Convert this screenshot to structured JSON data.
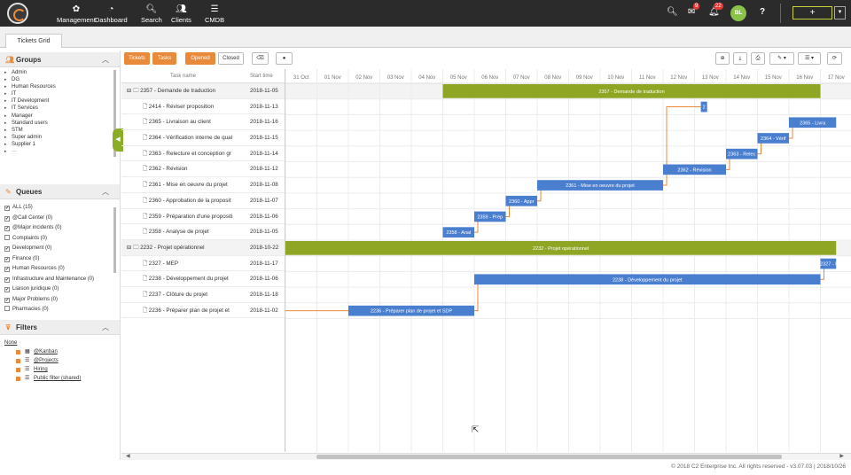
{
  "topbar": {
    "nav": [
      {
        "label": "Management",
        "icon": "gear-icon",
        "glyph": "✿"
      },
      {
        "label": "Dashboard",
        "icon": "dashboard-icon",
        "glyph": "◔"
      },
      {
        "label": "Search",
        "icon": "search-icon",
        "glyph": "🔍︎"
      },
      {
        "label": "Clients",
        "icon": "clients-icon",
        "glyph": "👥︎"
      },
      {
        "label": "CMDB",
        "icon": "database-icon",
        "glyph": "☰"
      }
    ],
    "messages_count": "9",
    "notifications_count": "22",
    "avatar_initials": "BL",
    "add_label": "+"
  },
  "tab": {
    "title": "Tickets Grid"
  },
  "sidebar": {
    "groups_title": "Groups",
    "groups": [
      "Admin",
      "DG",
      "Human Resources",
      "IT",
      "IT Development",
      "IT Services",
      "Manager",
      "Standard users",
      "STM",
      "Super admin",
      "Supplier 1",
      "···"
    ],
    "queues_title": "Queues",
    "queues": [
      {
        "label": "ALL (15)",
        "checked": true
      },
      {
        "label": "@Call Center (0)",
        "checked": true
      },
      {
        "label": "@Major incidents (0)",
        "checked": true
      },
      {
        "label": "Complaints (0)",
        "checked": false
      },
      {
        "label": "Development (0)",
        "checked": true
      },
      {
        "label": "Finance (0)",
        "checked": true
      },
      {
        "label": "Human Resources (0)",
        "checked": true
      },
      {
        "label": "Infrastructure and Maintenance (0)",
        "checked": true
      },
      {
        "label": "Liaison juridique (0)",
        "checked": true
      },
      {
        "label": "Major Problems (0)",
        "checked": true
      },
      {
        "label": "Pharmacies (0)",
        "checked": false
      }
    ],
    "filters_title": "Filters",
    "filters_none": "None",
    "filters": [
      "@Kanban",
      "@Projects",
      "Hiring",
      "Public filter (shared)"
    ]
  },
  "toolbar": {
    "tickets": "Tickets",
    "tasks": "Tasks",
    "opened": "Opened",
    "closed": "Closed"
  },
  "grid": {
    "col_task": "Task name",
    "col_start": "Start time",
    "rows": [
      {
        "name": "⊟ 🗀 2357 - Demande de traduction",
        "date": "2018-11-05",
        "parent": true
      },
      {
        "name": "🗋 2414 - Réviser proposition",
        "date": "2018-11-13",
        "parent": false
      },
      {
        "name": "🗋 2365 - Livraison au client",
        "date": "2018-11-16",
        "parent": false
      },
      {
        "name": "🗋 2364 - Vérification interne de qual",
        "date": "2018-11-15",
        "parent": false
      },
      {
        "name": "🗋 2363 - Relecture et conception gr",
        "date": "2018-11-14",
        "parent": false
      },
      {
        "name": "🗋 2362 - Révision",
        "date": "2018-11-12",
        "parent": false
      },
      {
        "name": "🗋 2361 - Mise en oeuvre du projet",
        "date": "2018-11-08",
        "parent": false
      },
      {
        "name": "🗋 2360 - Approbation de la proposit",
        "date": "2018-11-07",
        "parent": false
      },
      {
        "name": "🗋 2359 - Préparation d'une propositi",
        "date": "2018-11-06",
        "parent": false
      },
      {
        "name": "🗋 2358 - Analyse de projet",
        "date": "2018-11-05",
        "parent": false
      },
      {
        "name": "⊟ 🗀 2232 - Projet opérationnel",
        "date": "2018-10-22",
        "parent": true
      },
      {
        "name": "🗋 2327 - MEP",
        "date": "2018-11-17",
        "parent": false
      },
      {
        "name": "🗋 2238 - Développement du projet",
        "date": "2018-11-06",
        "parent": false
      },
      {
        "name": "🗋 2237 - Clôture du projet",
        "date": "2018-11-18",
        "parent": false
      },
      {
        "name": "🗋 2236 - Préparer plan de projet et",
        "date": "2018-11-02",
        "parent": false
      }
    ]
  },
  "timeline": {
    "days": [
      "31 Oct",
      "01 Nov",
      "02 Nov",
      "03 Nov",
      "04 Nov",
      "05 Nov",
      "06 Nov",
      "07 Nov",
      "08 Nov",
      "09 Nov",
      "10 Nov",
      "11 Nov",
      "12 Nov",
      "13 Nov",
      "14 Nov",
      "15 Nov",
      "16 Nov",
      "17 Nov"
    ],
    "bars": [
      {
        "row": 0,
        "start": 5,
        "end": 17.0,
        "label": "2357 - Demande de traduction",
        "kind": "parent"
      },
      {
        "row": 1,
        "start": 13.2,
        "end": 13.4,
        "label": "2",
        "kind": "task"
      },
      {
        "row": 2,
        "start": 16.0,
        "end": 17.5,
        "label": "2365 - Livra",
        "kind": "task"
      },
      {
        "row": 3,
        "start": 15.0,
        "end": 16.0,
        "label": "2364 - Vérif",
        "kind": "task"
      },
      {
        "row": 4,
        "start": 14.0,
        "end": 15.0,
        "label": "2363 - Relec",
        "kind": "task"
      },
      {
        "row": 5,
        "start": 12.0,
        "end": 14.0,
        "label": "2362 - Révision",
        "kind": "task"
      },
      {
        "row": 6,
        "start": 8.0,
        "end": 12.0,
        "label": "2361 - Mise en oeuvre du projet",
        "kind": "task"
      },
      {
        "row": 7,
        "start": 7.0,
        "end": 8.0,
        "label": "2360 - Appr",
        "kind": "task"
      },
      {
        "row": 8,
        "start": 6.0,
        "end": 7.0,
        "label": "2359 - Prép",
        "kind": "task"
      },
      {
        "row": 9,
        "start": 5.0,
        "end": 6.0,
        "label": "2358 - Anal",
        "kind": "task"
      },
      {
        "row": 10,
        "start": 0.0,
        "end": 17.5,
        "label": "2232 - Projet opérationnel",
        "kind": "parent"
      },
      {
        "row": 11,
        "start": 17.0,
        "end": 17.5,
        "label": "2327 - I",
        "kind": "task"
      },
      {
        "row": 12,
        "start": 6.0,
        "end": 17.0,
        "label": "2238 - Développement du projet",
        "kind": "task"
      },
      {
        "row": 14,
        "start": 2.0,
        "end": 6.0,
        "label": "2236 - Préparer plan de projet et SDP",
        "kind": "task"
      }
    ],
    "colors": {
      "parent": "#8ea624",
      "task": "#4a7fd0",
      "link": "#e98a3a",
      "grid": "#ececec"
    }
  },
  "footer": "© 2018 C2 Enterprise Inc. All rights reserved - v3.07.03 | 2018/10/26"
}
